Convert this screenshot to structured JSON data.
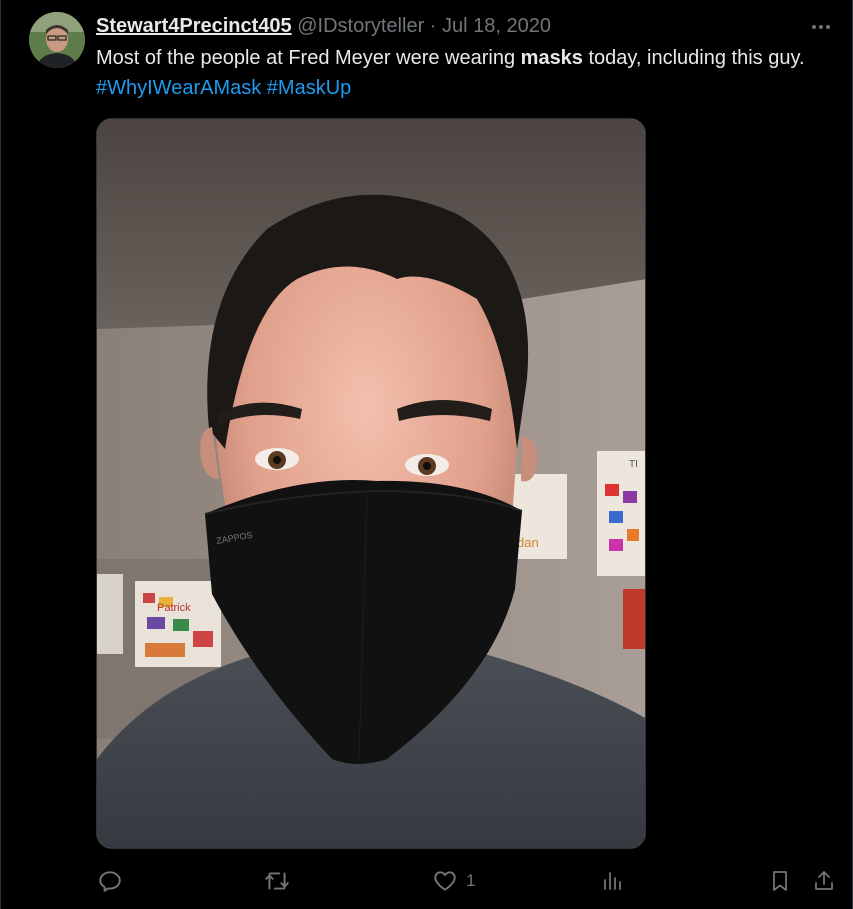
{
  "tweet": {
    "display_name": "Stewart4Precinct405",
    "handle": "@IDstoryteller",
    "separator": "·",
    "date": "Jul 18, 2020",
    "text_before": "Most of the people at Fred Meyer were wearing ",
    "text_bold": "masks",
    "text_after": " today, including this guy. ",
    "hashtag_1": "#WhyIWearAMask",
    "hashtag_2": "#MaskUp"
  },
  "media": {
    "mask_print": "ZAPPOS",
    "drawing_1": "dan",
    "drawing_2": "Patrick",
    "drawing_3": "TI"
  },
  "actions": {
    "reply_count": "",
    "retweet_count": "",
    "like_count": "1",
    "views_count": ""
  },
  "icons": {
    "more": "more-icon",
    "reply": "reply-icon",
    "retweet": "retweet-icon",
    "like": "heart-icon",
    "views": "views-icon",
    "bookmark": "bookmark-icon",
    "share": "share-icon"
  },
  "colors": {
    "background": "#000000",
    "text": "#e7e9ea",
    "muted": "#71767b",
    "link": "#1d9bf0"
  }
}
